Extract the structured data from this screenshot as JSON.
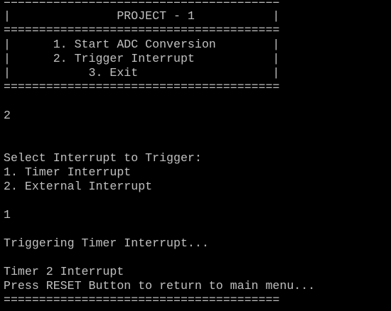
{
  "terminal": {
    "colors": {
      "background": "#000000",
      "foreground": "#c0c0c0"
    },
    "lines": [
      "=======================================",
      "|               PROJECT - 1           |",
      "=======================================",
      "|      1. Start ADC Conversion        |",
      "|      2. Trigger Interrupt           |",
      "|           3. Exit                   |",
      "=======================================",
      "",
      "2",
      "",
      "",
      "Select Interrupt to Trigger:",
      "1. Timer Interrupt",
      "2. External Interrupt",
      "",
      "1",
      "",
      "Triggering Timer Interrupt...",
      "",
      "Timer 2 Interrupt",
      "Press RESET Button to return to main menu...",
      "======================================="
    ]
  }
}
